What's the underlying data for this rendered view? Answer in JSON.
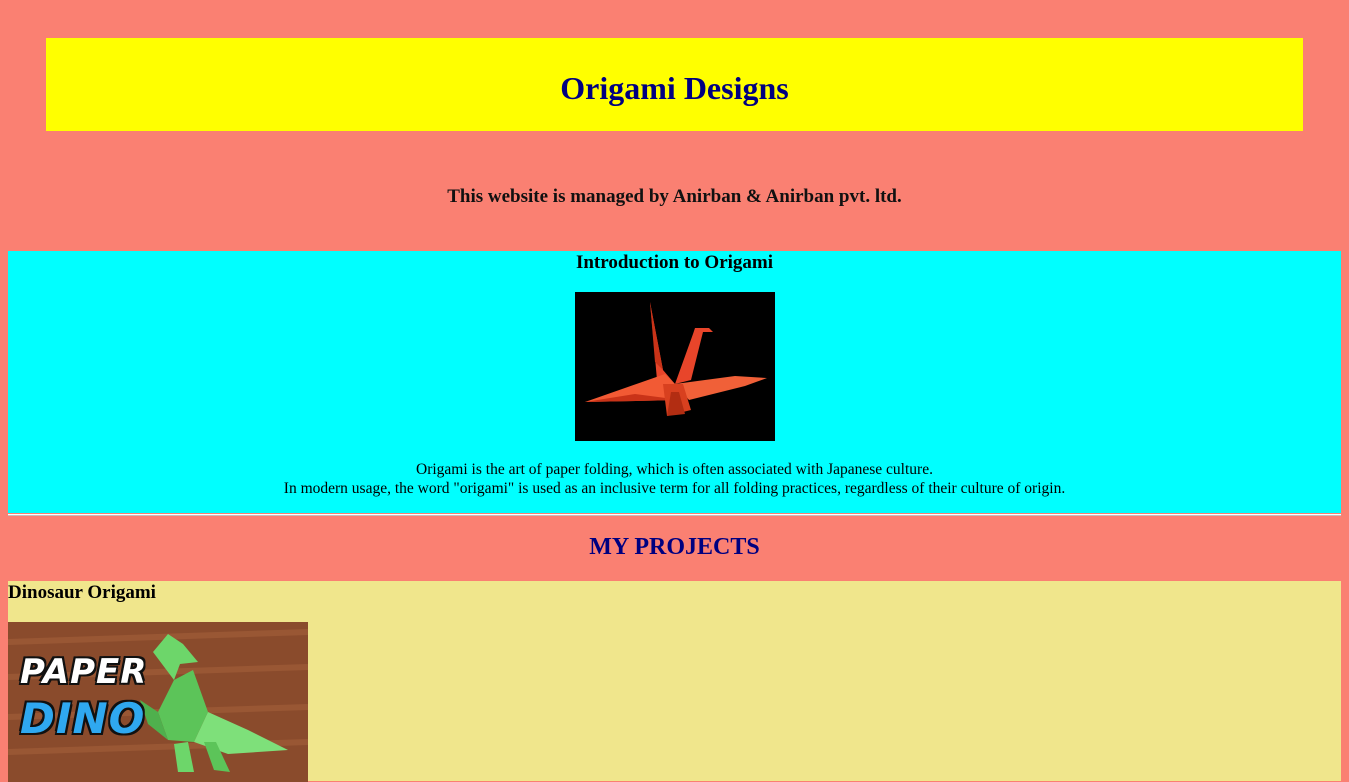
{
  "header": {
    "title": "Origami Designs",
    "banner_color": "#ffff00"
  },
  "manager_text": "This website is managed by Anirban & Anirban pvt. ltd.",
  "intro": {
    "heading": "Introduction to Origami",
    "image": {
      "icon": "origami-crane-image"
    },
    "line1": "Origami is the art of paper folding, which is often associated with Japanese culture.",
    "line2": "In modern usage, the word \"origami\" is used as an inclusive term for all folding practices, regardless of their culture of origin.",
    "bg_color": "#00ffff"
  },
  "projects": {
    "title": "MY PROJECTS",
    "items": [
      {
        "heading": "Dinosaur Origami",
        "image": {
          "icon": "paper-dino-image",
          "caption_top": "PAPER",
          "caption_bottom": "DINO"
        }
      }
    ]
  },
  "colors": {
    "page_bg": "#fa8072",
    "title_color": "#000080",
    "project_bg": "#f0e68c"
  }
}
